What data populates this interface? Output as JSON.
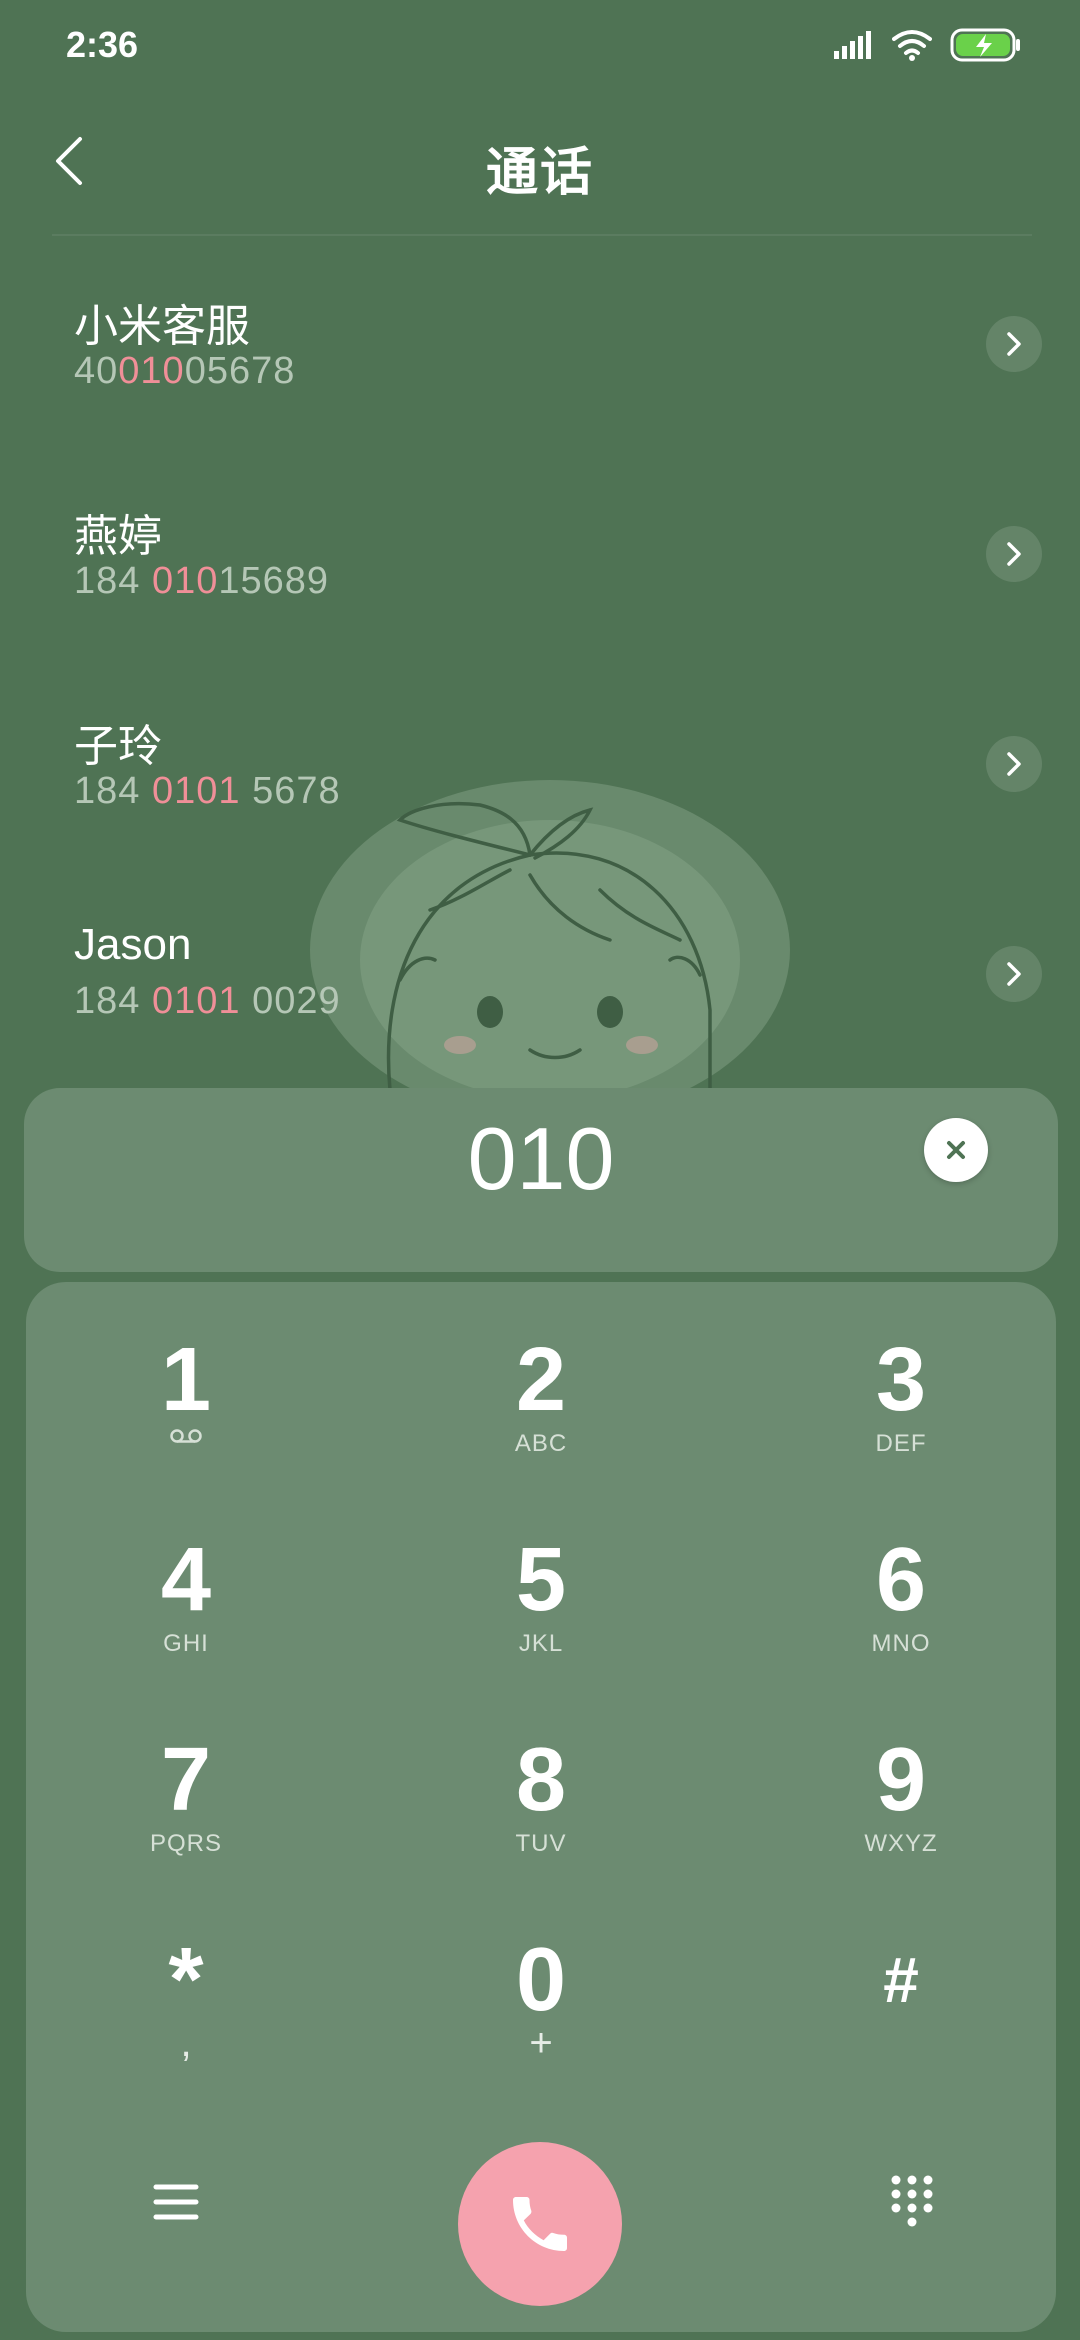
{
  "status_bar": {
    "time": "2:36"
  },
  "header": {
    "title": "通话"
  },
  "contacts": [
    {
      "name": "小米客服",
      "number_pre": "40",
      "number_hl": "010",
      "number_post": "05678"
    },
    {
      "name": "燕婷",
      "number_pre": "184 ",
      "number_hl": "010",
      "number_post": "15689"
    },
    {
      "name": "子玲",
      "number_pre": "184 ",
      "number_hl": "0101",
      "number_post": " 5678"
    },
    {
      "name": "Jason",
      "number_pre": "184 ",
      "number_hl": "0101",
      "number_post": " 0029"
    }
  ],
  "dial_input": {
    "value": "010"
  },
  "keys": [
    {
      "digit": "1",
      "letters": ""
    },
    {
      "digit": "2",
      "letters": "ABC"
    },
    {
      "digit": "3",
      "letters": "DEF"
    },
    {
      "digit": "4",
      "letters": "GHI"
    },
    {
      "digit": "5",
      "letters": "JKL"
    },
    {
      "digit": "6",
      "letters": "MNO"
    },
    {
      "digit": "7",
      "letters": "PQRS"
    },
    {
      "digit": "8",
      "letters": "TUV"
    },
    {
      "digit": "9",
      "letters": "WXYZ"
    },
    {
      "digit": "*",
      "letters": ","
    },
    {
      "digit": "0",
      "letters": "+"
    },
    {
      "digit": "#",
      "letters": ""
    }
  ],
  "icons": {
    "back": "chevron-left-icon",
    "arrow": "chevron-right-icon",
    "clear": "close-icon",
    "voicemail": "voicemail-icon",
    "menu": "menu-icon",
    "call": "phone-icon",
    "keypad": "dialpad-icon",
    "signal": "signal-icon",
    "wifi": "wifi-icon",
    "battery": "battery-charging-icon"
  },
  "colors": {
    "background": "#4f7354",
    "panel": "#6c8b71",
    "highlight": "#f08f98",
    "call_button": "#f5a2ae",
    "battery": "#6ad14a"
  }
}
